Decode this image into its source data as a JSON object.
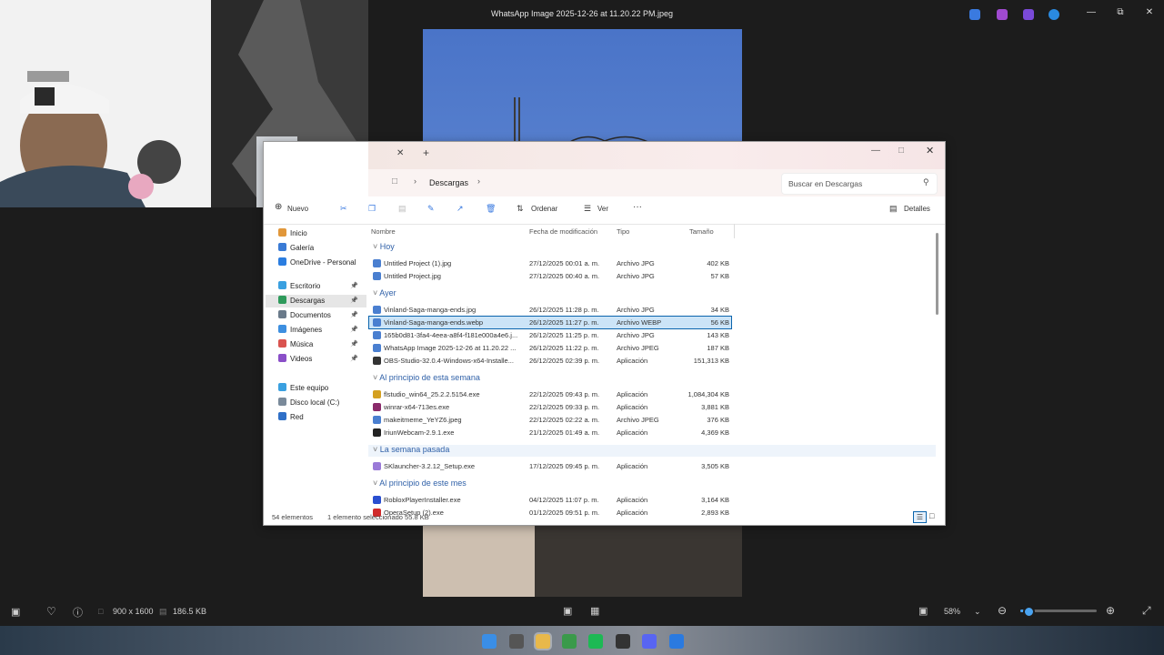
{
  "viewer": {
    "title": "WhatsApp Image 2025-12-26 at 11.20.22 PM.jpeg",
    "dimensions": "900 x 1600",
    "size": "186.5 KB",
    "zoom": "58%",
    "zoom_fraction": 0.05
  },
  "explorer": {
    "address": "Descargas",
    "search_placeholder": "Buscar en Descargas",
    "new_label": "Nuevo",
    "sort_label": "Ordenar",
    "view_label": "Ver",
    "details_label": "Detalles",
    "more_label": "···",
    "columns": {
      "name": "Nombre",
      "date": "Fecha de modificación",
      "type": "Tipo",
      "size": "Tamaño"
    },
    "sidebar": [
      {
        "label": "Inicio",
        "color": "#e1973a"
      },
      {
        "label": "Galería",
        "color": "#3a7bd5"
      },
      {
        "label": "OneDrive - Personal",
        "color": "#2b7de0"
      },
      {
        "label": "Escritorio",
        "color": "#3aa0e0"
      },
      {
        "label": "Descargas",
        "color": "#2e9a5b"
      },
      {
        "label": "Documentos",
        "color": "#6a7a8a"
      },
      {
        "label": "Imágenes",
        "color": "#3d8fe0"
      },
      {
        "label": "Música",
        "color": "#d9534f"
      },
      {
        "label": "Videos",
        "color": "#8a4fc8"
      },
      {
        "label": "Este equipo",
        "color": "#3aa0e0"
      },
      {
        "label": "Disco local (C:)",
        "color": "#7a8a9a"
      },
      {
        "label": "Red",
        "color": "#2f6fc7"
      }
    ],
    "groups": [
      {
        "label": "Hoy",
        "files": [
          {
            "name": "Untitled Project (1).jpg",
            "date": "27/12/2025 00:01 a. m.",
            "type": "Archivo JPG",
            "size": "402 KB",
            "color": "#4a7fd0"
          },
          {
            "name": "Untitled Project.jpg",
            "date": "27/12/2025 00:40 a. m.",
            "type": "Archivo JPG",
            "size": "57 KB",
            "color": "#4a7fd0"
          }
        ]
      },
      {
        "label": "Ayer",
        "files": [
          {
            "name": "Vinland-Saga-manga-ends.jpg",
            "date": "26/12/2025 11:28 p. m.",
            "type": "Archivo JPG",
            "size": "34 KB",
            "color": "#4a7fd0"
          },
          {
            "name": "Vinland-Saga-manga-ends.webp",
            "date": "26/12/2025 11:27 p. m.",
            "type": "Archivo WEBP",
            "size": "56 KB",
            "color": "#4a7fd0"
          },
          {
            "name": "165b0d81-3fa4-4eea-a8f4-f181e000a4e6.j...",
            "date": "26/12/2025 11:25 p. m.",
            "type": "Archivo JPG",
            "size": "143 KB",
            "color": "#4a7fd0"
          },
          {
            "name": "WhatsApp Image 2025-12-26 at 11.20.22 ...",
            "date": "26/12/2025 11:22 p. m.",
            "type": "Archivo JPEG",
            "size": "187 KB",
            "color": "#4a7fd0"
          },
          {
            "name": "OBS-Studio-32.0.4-Windows-x64-Installe...",
            "date": "26/12/2025 02:39 p. m.",
            "type": "Aplicación",
            "size": "151,313 KB",
            "color": "#333333"
          }
        ]
      },
      {
        "label": "Al principio de esta semana",
        "files": [
          {
            "name": "flstudio_win64_25.2.2.5154.exe",
            "date": "22/12/2025 09:43 p. m.",
            "type": "Aplicación",
            "size": "1,084,304 KB",
            "color": "#d4a020"
          },
          {
            "name": "winrar-x64-713es.exe",
            "date": "22/12/2025 09:33 p. m.",
            "type": "Aplicación",
            "size": "3,881 KB",
            "color": "#8a2a6a"
          },
          {
            "name": "makeitmeme_YeYZ6.jpeg",
            "date": "22/12/2025 02:22 a. m.",
            "type": "Archivo JPEG",
            "size": "376 KB",
            "color": "#4a7fd0"
          },
          {
            "name": "IriunWebcam-2.9.1.exe",
            "date": "21/12/2025 01:49 a. m.",
            "type": "Aplicación",
            "size": "4,369 KB",
            "color": "#222222"
          }
        ]
      },
      {
        "label": "La semana pasada",
        "files": [
          {
            "name": "SKlauncher-3.2.12_Setup.exe",
            "date": "17/12/2025 09:45 p. m.",
            "type": "Aplicación",
            "size": "3,505 KB",
            "color": "#9a7ad8"
          }
        ]
      },
      {
        "label": "Al principio de este mes",
        "files": [
          {
            "name": "RobloxPlayerInstaller.exe",
            "date": "04/12/2025 11:07 p. m.",
            "type": "Aplicación",
            "size": "3,164 KB",
            "color": "#2a4fd0"
          },
          {
            "name": "OperaSetup (2).exe",
            "date": "01/12/2025 09:51 p. m.",
            "type": "Aplicación",
            "size": "2,893 KB",
            "color": "#d02a2a"
          }
        ]
      }
    ],
    "status": {
      "count": "54 elementos",
      "selection": "1 elemento seleccionado  55.8 KB"
    }
  },
  "taskbar": {
    "icons": [
      {
        "name": "windows-start-icon",
        "color": "#3a8ee6"
      },
      {
        "name": "search-icon",
        "color": "#555555"
      },
      {
        "name": "file-explorer-icon",
        "color": "#e8b84a"
      },
      {
        "name": "chrome-icon",
        "color": "#3a9a4a"
      },
      {
        "name": "spotify-icon",
        "color": "#1db954"
      },
      {
        "name": "obs-icon",
        "color": "#333333"
      },
      {
        "name": "discord-icon",
        "color": "#5865f2"
      },
      {
        "name": "paint-icon",
        "color": "#2a7ae0"
      }
    ]
  }
}
